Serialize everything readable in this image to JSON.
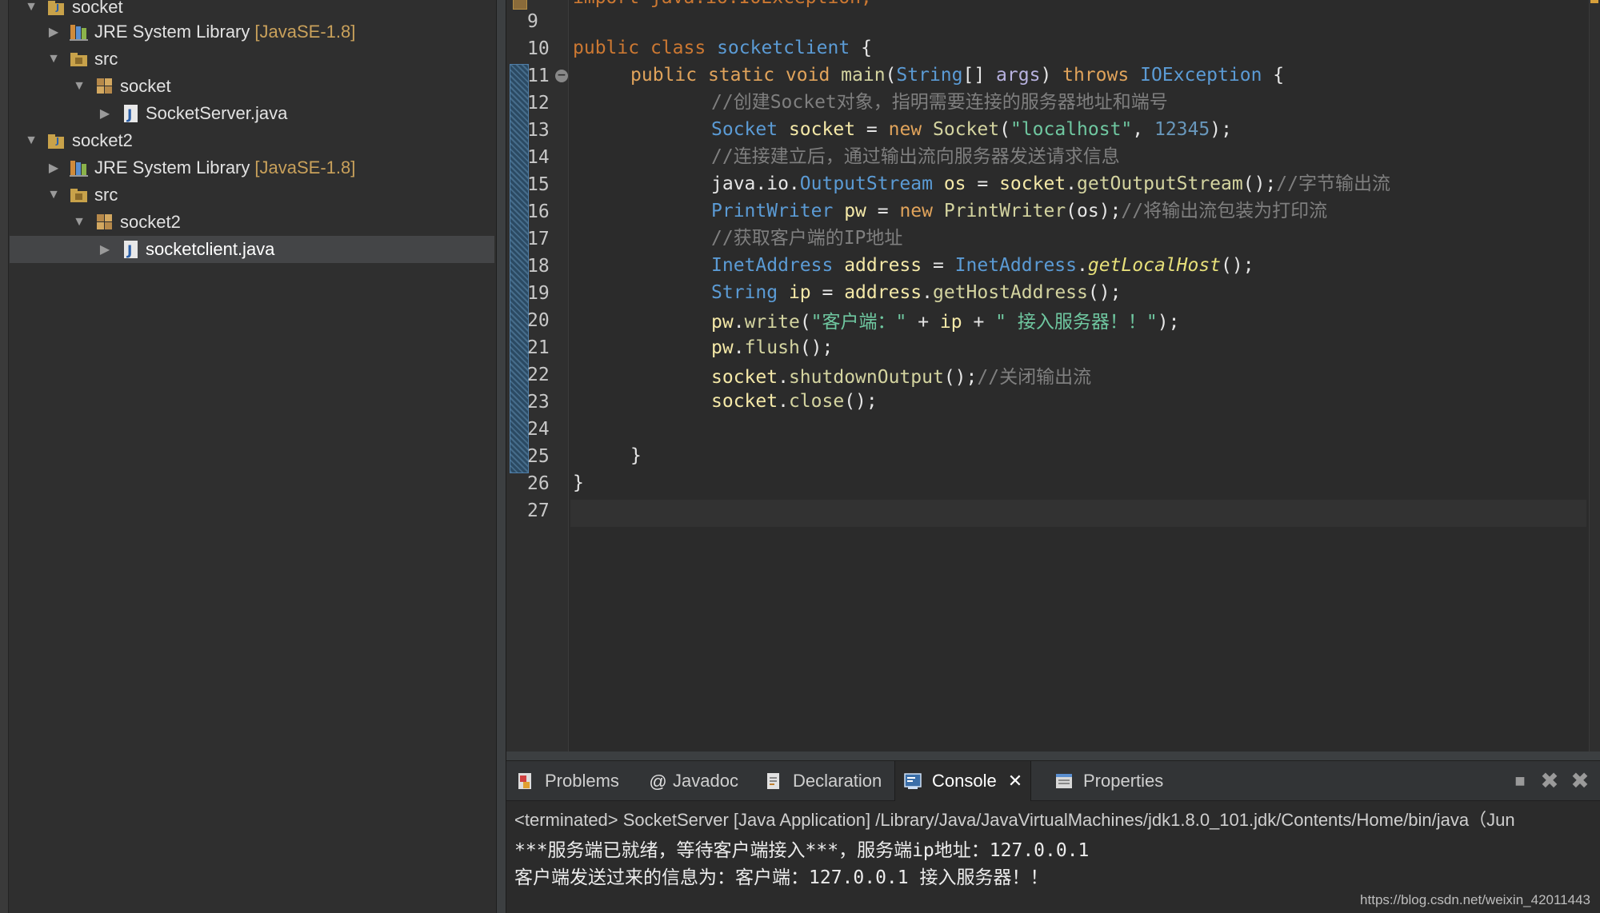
{
  "explorer": {
    "items": [
      {
        "label": "socket",
        "decoration": ""
      },
      {
        "label": "JRE System Library",
        "decoration": "[JavaSE-1.8]"
      },
      {
        "label": "src",
        "decoration": ""
      },
      {
        "label": "socket",
        "decoration": ""
      },
      {
        "label": "SocketServer.java",
        "decoration": ""
      },
      {
        "label": "socket2",
        "decoration": ""
      },
      {
        "label": "JRE System Library",
        "decoration": "[JavaSE-1.8]"
      },
      {
        "label": "src",
        "decoration": ""
      },
      {
        "label": "socket2",
        "decoration": ""
      },
      {
        "label": "socketclient.java",
        "decoration": ""
      }
    ]
  },
  "editor": {
    "top_partial": "import java.io.IOException;",
    "line_numbers": [
      "9",
      "10",
      "11",
      "12",
      "13",
      "14",
      "15",
      "16",
      "17",
      "18",
      "19",
      "20",
      "21",
      "22",
      "23",
      "24",
      "25",
      "26",
      "27"
    ],
    "code": {
      "l10": [
        "public",
        "class",
        "socketclient",
        "{"
      ],
      "l11": [
        "public",
        "static",
        "void",
        "main",
        "(",
        "String",
        "[] ",
        "args",
        ") ",
        "throws",
        "IOException",
        " {"
      ],
      "l12": "//创建Socket对象，指明需要连接的服务器地址和端号",
      "l13": [
        "Socket",
        "socket",
        " = ",
        "new",
        "Socket",
        "(",
        "\"localhost\"",
        ", ",
        "12345",
        ");"
      ],
      "l14": "//连接建立后，通过输出流向服务器发送请求信息",
      "l15": [
        "java.io.",
        "OutputStream",
        "os",
        " = ",
        "socket",
        ".",
        "getOutputStream",
        "();",
        "//字节输出流"
      ],
      "l16": [
        "PrintWriter",
        "pw",
        " = ",
        "new",
        "PrintWriter",
        "(os);",
        "//将输出流包装为打印流"
      ],
      "l17": "//获取客户端的IP地址",
      "l18": [
        "InetAddress",
        "address",
        " = ",
        "InetAddress",
        ".",
        "getLocalHost",
        "();"
      ],
      "l19": [
        "String",
        "ip",
        " = ",
        "address",
        ".",
        "getHostAddress",
        "();"
      ],
      "l20": [
        "pw",
        ".",
        "write",
        "(",
        "\"客户端：\"",
        " + ",
        "ip",
        " + ",
        "\" 接入服务器！！\"",
        ");"
      ],
      "l21": [
        "pw",
        ".",
        "flush",
        "();"
      ],
      "l22": [
        "socket",
        ".",
        "shutdownOutput",
        "();",
        "//关闭输出流"
      ],
      "l23": [
        "socket",
        ".",
        "close",
        "();"
      ],
      "l25": "}",
      "l26": "}"
    }
  },
  "bottom": {
    "tabs": [
      {
        "label": "Problems",
        "icon": "problems-icon"
      },
      {
        "label": "Javadoc",
        "icon": "javadoc-icon"
      },
      {
        "label": "Declaration",
        "icon": "declaration-icon"
      },
      {
        "label": "Console",
        "icon": "console-icon"
      },
      {
        "label": "Properties",
        "icon": "properties-icon"
      }
    ],
    "console_header": "<terminated> SocketServer [Java Application] /Library/Java/JavaVirtualMachines/jdk1.8.0_101.jdk/Contents/Home/bin/java（Jun",
    "console_lines": [
      "***服务端已就绪，等待客户端接入***，服务端ip地址：127.0.0.1",
      "客户端发送过来的信息为：客户端：127.0.0.1 接入服务器！！"
    ]
  },
  "watermark": "https://blog.csdn.net/weixin_42011443"
}
